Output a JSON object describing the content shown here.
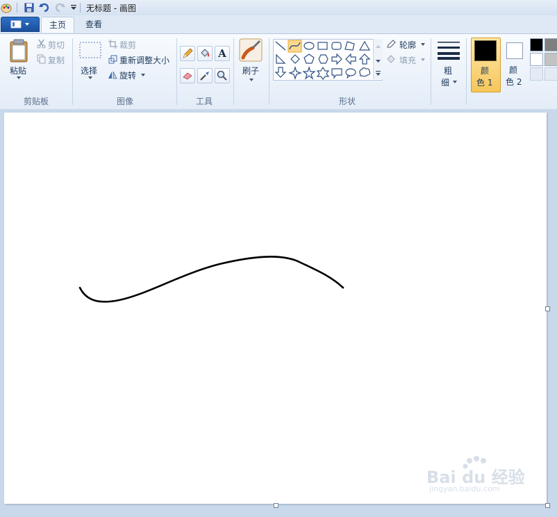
{
  "title_bar": {
    "app_title": "无标题 - 画图",
    "icons": [
      "paint-app-icon",
      "save-icon",
      "undo-icon",
      "redo-icon",
      "customize-dropdown-icon"
    ]
  },
  "tabs": [
    {
      "label": "主页",
      "active": true
    },
    {
      "label": "查看",
      "active": false
    }
  ],
  "ribbon": {
    "clipboard": {
      "paste_label": "粘贴",
      "cut_label": "剪切",
      "copy_label": "复制",
      "group_label": "剪贴板"
    },
    "image": {
      "select_label": "选择",
      "crop_label": "裁剪",
      "resize_label": "重新调整大小",
      "rotate_label": "旋转",
      "group_label": "图像"
    },
    "tools": {
      "group_label": "工具",
      "items": [
        "pencil-icon",
        "fill-icon",
        "text-icon",
        "eraser-icon",
        "color-picker-icon",
        "magnifier-icon"
      ],
      "text_glyph": "A"
    },
    "brushes": {
      "label": "刷子"
    },
    "shapes": {
      "group_label": "形状",
      "outline_label": "轮廓",
      "fill_label": "填充",
      "selected_shape": "curve"
    },
    "size": {
      "line1": "粗",
      "line2": "细"
    },
    "color1": {
      "line1": "颜",
      "line2": "色 1",
      "value": "#000000"
    },
    "color2": {
      "line1": "颜",
      "line2": "色 2",
      "value": "#ffffff"
    },
    "palette": [
      "#000000",
      "#7f7f7f",
      "#ffffff",
      "#c3c3c3"
    ]
  },
  "canvas": {
    "stroke_color": "#000000"
  },
  "watermark": {
    "brand": "Bai du 经验",
    "url": "jingyan.baidu.com"
  }
}
